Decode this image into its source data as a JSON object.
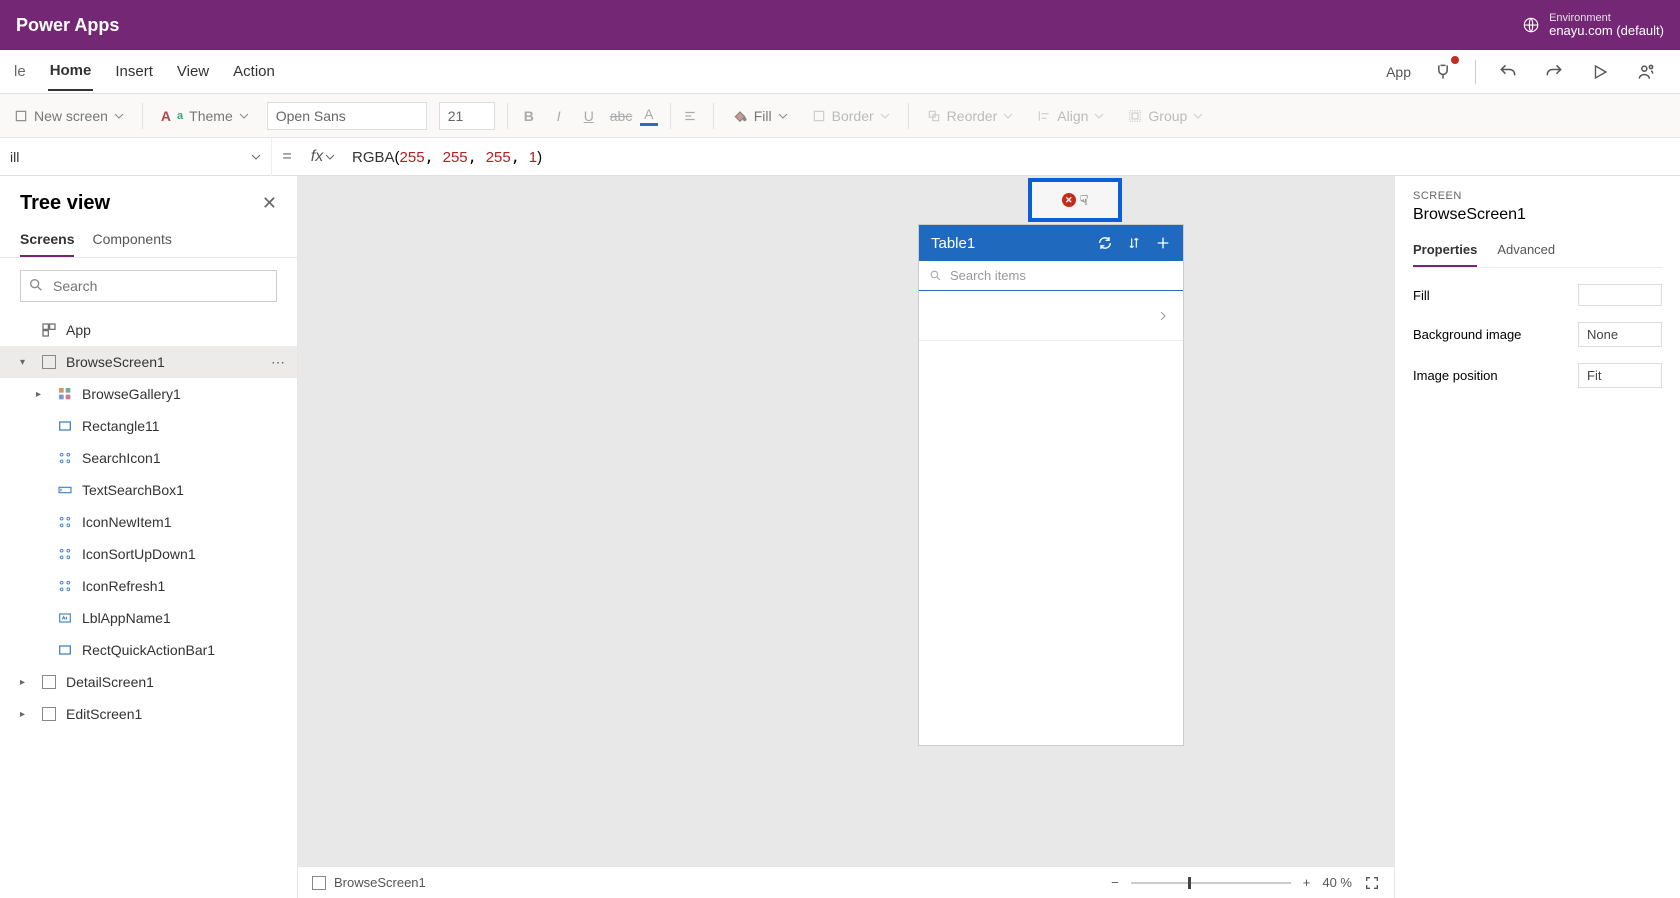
{
  "header": {
    "title": "Power Apps",
    "env_label": "Environment",
    "env_name": "enayu.com (default)"
  },
  "menu": {
    "items": [
      "le",
      "Home",
      "Insert",
      "View",
      "Action"
    ],
    "active": "Home",
    "app_label": "App"
  },
  "toolbar": {
    "new_screen": "New screen",
    "theme": "Theme",
    "font_name": "Open Sans",
    "font_size": "21",
    "fill": "Fill",
    "border": "Border",
    "reorder": "Reorder",
    "align": "Align",
    "group": "Group"
  },
  "formula": {
    "property": "ill",
    "text_prefix": "RGBA",
    "args": "(255, 255, 255, 1)"
  },
  "tree": {
    "title": "Tree view",
    "tabs": [
      "Screens",
      "Components"
    ],
    "active_tab": "Screens",
    "search_placeholder": "Search",
    "items": [
      {
        "label": "App",
        "icon": "app",
        "indent": 0,
        "chev": ""
      },
      {
        "label": "BrowseScreen1",
        "icon": "screen",
        "indent": 0,
        "chev": "v",
        "selected": true,
        "more": true
      },
      {
        "label": "BrowseGallery1",
        "icon": "gallery",
        "indent": 1,
        "chev": ">"
      },
      {
        "label": "Rectangle11",
        "icon": "rect",
        "indent": 2
      },
      {
        "label": "SearchIcon1",
        "icon": "icon",
        "indent": 2
      },
      {
        "label": "TextSearchBox1",
        "icon": "textbox",
        "indent": 2
      },
      {
        "label": "IconNewItem1",
        "icon": "icon",
        "indent": 2
      },
      {
        "label": "IconSortUpDown1",
        "icon": "icon",
        "indent": 2
      },
      {
        "label": "IconRefresh1",
        "icon": "icon",
        "indent": 2
      },
      {
        "label": "LblAppName1",
        "icon": "label",
        "indent": 2
      },
      {
        "label": "RectQuickActionBar1",
        "icon": "rect",
        "indent": 2
      },
      {
        "label": "DetailScreen1",
        "icon": "screen",
        "indent": 0,
        "chev": ">"
      },
      {
        "label": "EditScreen1",
        "icon": "screen",
        "indent": 0,
        "chev": ">"
      }
    ]
  },
  "canvas": {
    "app_title": "Table1",
    "search_placeholder": "Search items",
    "footer_crumb": "BrowseScreen1",
    "zoom": "40 %"
  },
  "props": {
    "section": "SCREEN",
    "name": "BrowseScreen1",
    "tabs": [
      "Properties",
      "Advanced"
    ],
    "active_tab": "Properties",
    "rows": [
      {
        "label": "Fill",
        "value": ""
      },
      {
        "label": "Background image",
        "value": "None"
      },
      {
        "label": "Image position",
        "value": "Fit"
      }
    ]
  }
}
